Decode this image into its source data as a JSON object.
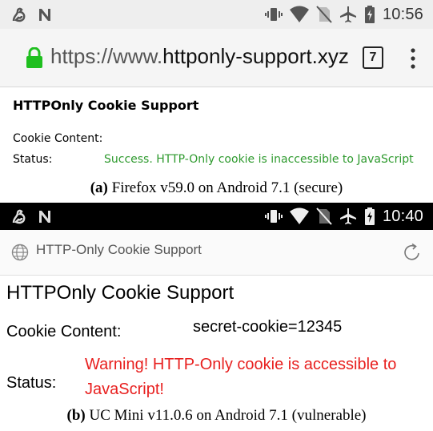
{
  "panel_a": {
    "statusbar": {
      "time": "10:56"
    },
    "urlbar": {
      "url_prefix": "https://www.",
      "url_domain": "httponly-support.xyz",
      "tab_count": "7"
    },
    "page": {
      "title": "HTTPOnly Cookie Support",
      "cookie_label": "Cookie Content:",
      "status_label": "Status:",
      "status_value": "Success. HTTP-Only cookie is inaccessible to JavaScript"
    },
    "caption": {
      "tag": "(a)",
      "text": " Firefox v59.0 on Android 7.1 (secure)"
    },
    "colors": {
      "status_success": "#2e9a2e"
    }
  },
  "panel_b": {
    "statusbar": {
      "time": "10:40"
    },
    "toolbar": {
      "title": "HTTP-Only Cookie Support"
    },
    "page": {
      "title": "HTTPOnly Cookie Support",
      "cookie_label": "Cookie Content:",
      "cookie_value": "secret-cookie=12345",
      "status_label": "Status:",
      "status_value": "Warning! HTTP-Only cookie is accessible to JavaScript!"
    },
    "caption": {
      "tag": "(b)",
      "text": " UC Mini v11.0.6 on Android 7.1 (vulnerable)"
    },
    "colors": {
      "status_warning": "#e8201f"
    }
  },
  "icons": [
    "notification-app-icon",
    "n-letter-icon",
    "vibrate-icon",
    "wifi-icon",
    "no-sim-icon",
    "airplane-icon",
    "battery-charging-icon",
    "lock-icon",
    "overflow-menu-icon",
    "globe-icon",
    "reload-icon"
  ]
}
